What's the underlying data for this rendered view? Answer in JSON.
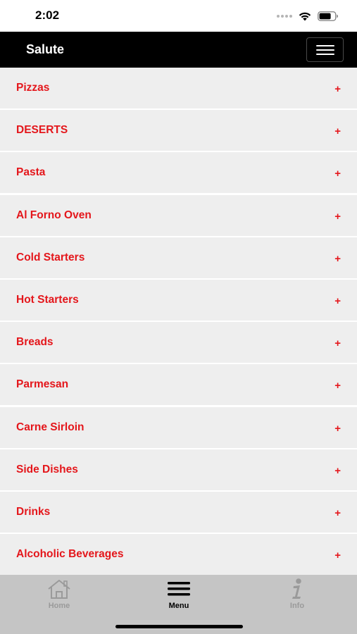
{
  "status_bar": {
    "time": "2:02"
  },
  "header": {
    "title": "Salute"
  },
  "menu": {
    "items": [
      {
        "label": "Pizzas",
        "expand": "+"
      },
      {
        "label": "DESERTS",
        "expand": "+"
      },
      {
        "label": "Pasta",
        "expand": "+"
      },
      {
        "label": "Al Forno Oven",
        "expand": "+"
      },
      {
        "label": "Cold Starters",
        "expand": "+"
      },
      {
        "label": "Hot Starters",
        "expand": "+"
      },
      {
        "label": "Breads",
        "expand": "+"
      },
      {
        "label": "Parmesan",
        "expand": "+"
      },
      {
        "label": "Carne Sirloin",
        "expand": "+"
      },
      {
        "label": "Side Dishes",
        "expand": "+"
      },
      {
        "label": "Drinks",
        "expand": "+"
      },
      {
        "label": "Alcoholic Beverages",
        "expand": "+"
      }
    ]
  },
  "tab_bar": {
    "tabs": [
      {
        "label": "Home",
        "icon": "home-icon",
        "active": false
      },
      {
        "label": "Menu",
        "icon": "hamburger-icon",
        "active": true
      },
      {
        "label": "Info",
        "icon": "info-icon",
        "active": false
      }
    ]
  },
  "colors": {
    "accent": "#e4161b",
    "header_bg": "#000000",
    "row_bg": "#eeeeee",
    "tab_bar_bg": "#c5c5c5"
  }
}
